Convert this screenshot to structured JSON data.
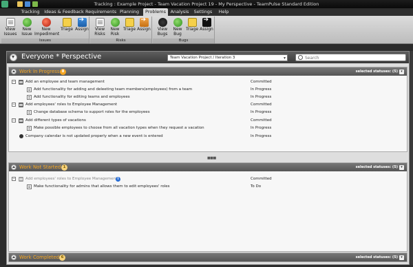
{
  "window": {
    "title": "Tracking : Example Project - Team Vacation Project 19 - My Perspective  -  TeamPulse Standard Edition"
  },
  "menu": {
    "tabs": [
      "Tracking",
      "Ideas & Feedback",
      "Requirements",
      "Planning",
      "Problems",
      "Analysis",
      "Settings",
      "Help"
    ],
    "active": "Problems"
  },
  "ribbon": {
    "groups": [
      {
        "label": "Issues",
        "buttons": [
          {
            "line1": "View",
            "line2": "Issues",
            "icon": "document-icon"
          },
          {
            "line1": "New",
            "line2": "Issue",
            "icon": "add-icon"
          },
          {
            "line1": "New",
            "line2": "Impediment",
            "icon": "impediment-icon"
          },
          {
            "line1": "Triage",
            "line2": "",
            "icon": "triage-icon"
          },
          {
            "line1": "Assign",
            "line2": "",
            "icon": "assign-arrow-icon"
          }
        ]
      },
      {
        "label": "Risks",
        "buttons": [
          {
            "line1": "View",
            "line2": "Risks",
            "icon": "document-icon"
          },
          {
            "line1": "New",
            "line2": "Risk",
            "icon": "add-icon"
          },
          {
            "line1": "Triage",
            "line2": "",
            "icon": "triage-icon"
          },
          {
            "line1": "Assign",
            "line2": "",
            "icon": "assign-arrow-icon"
          }
        ]
      },
      {
        "label": "Bugs",
        "buttons": [
          {
            "line1": "View",
            "line2": "Bugs",
            "icon": "bug-icon"
          },
          {
            "line1": "New",
            "line2": "Bug",
            "icon": "add-icon"
          },
          {
            "line1": "Triage",
            "line2": "",
            "icon": "triage-icon"
          },
          {
            "line1": "Assign",
            "line2": "",
            "icon": "assign-arrow-icon"
          }
        ]
      }
    ]
  },
  "perspective": {
    "title": "Everyone * Perspective",
    "project_selected": "Team Vacation Project / Iteration 3",
    "search_placeholder": "Search"
  },
  "sections": {
    "wip": {
      "title": "Work In Progress",
      "count": "8",
      "statuses": "selected statuses: (5)",
      "rows": [
        {
          "text": "Add an employee and team management",
          "status": "Committed",
          "kind": "story"
        },
        {
          "text": "Add functionality for adding and deleeting team members(employees) from a team",
          "status": "In Progress",
          "kind": "task"
        },
        {
          "text": "Add functionality for editing teams and employees",
          "status": "In Progress",
          "kind": "task"
        },
        {
          "text": "Add employees' roles to Employee Management",
          "status": "Committed",
          "kind": "story"
        },
        {
          "text": "Change database schema to support roles for the employees",
          "status": "In Progress",
          "kind": "task"
        },
        {
          "text": "Add different types of vacations",
          "status": "Committed",
          "kind": "story"
        },
        {
          "text": "Make possible employees to choose from all vacation types when they request a vacation",
          "status": "In Progress",
          "kind": "task"
        },
        {
          "text": "Company calendar is not updated properly when a new event is entered",
          "status": "In Progress",
          "kind": "bug"
        }
      ]
    },
    "not_started": {
      "title": "Work Not Started",
      "count": "1",
      "statuses": "selected statuses: (5)",
      "rows": [
        {
          "text": "Add employees' roles to Employee Management",
          "status": "Committed",
          "kind": "story"
        },
        {
          "text": "Make functionality for admins that allows them to edit employees' roles",
          "status": "To Do",
          "kind": "task"
        }
      ]
    },
    "completed": {
      "title": "Work Completed",
      "count": "6",
      "statuses": "selected statuses: (5)"
    }
  },
  "colors": {
    "section_title": "#f5a623",
    "header_dark": "#555555",
    "panel": "#f7f7f7"
  }
}
